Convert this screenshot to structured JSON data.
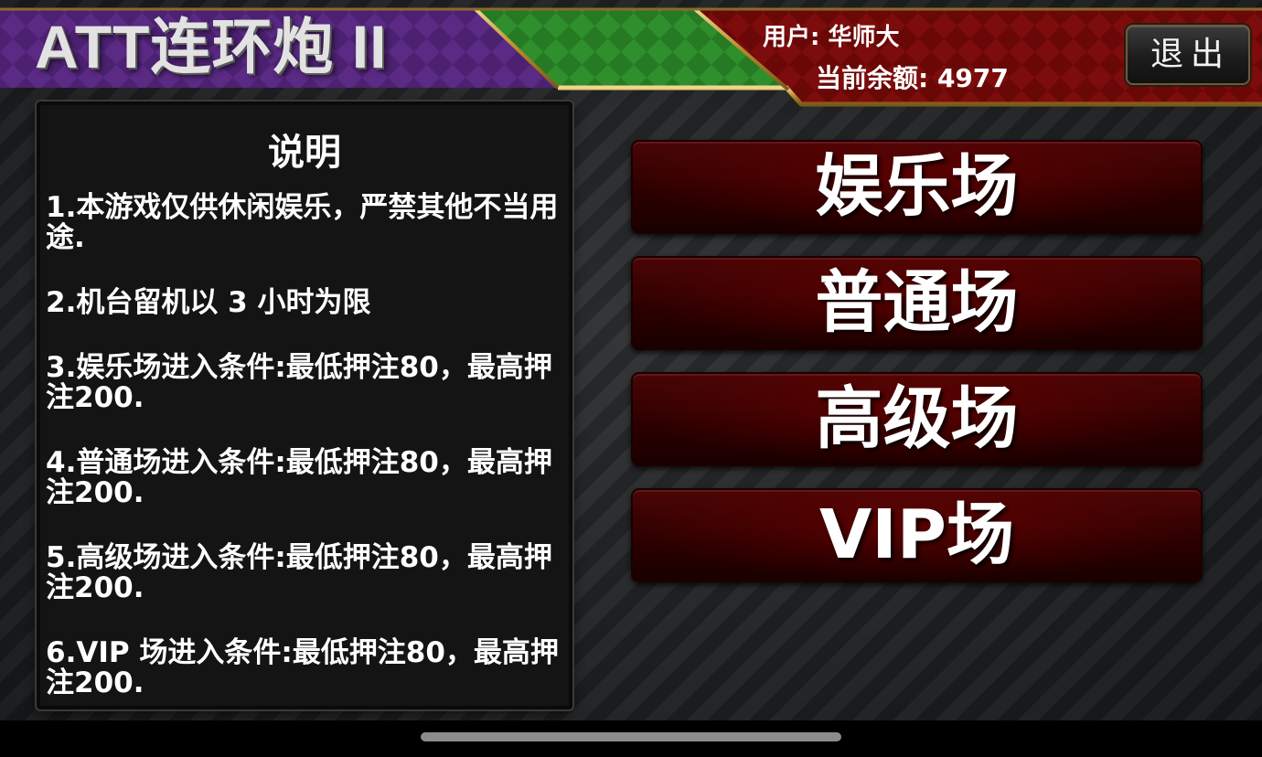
{
  "header": {
    "game_title": "ATT连环炮 II",
    "user_text": "用户: 华师大",
    "balance_text": "当前余额: 4977",
    "exit_label": "退出"
  },
  "instructions": {
    "title": "说明",
    "rules": [
      "1.本游戏仅供休闲娱乐，严禁其他不当用途.",
      "2.机台留机以  3 小时为限",
      "3.娱乐场进入条件:最低押注80，最高押注200.",
      "4.普通场进入条件:最低押注80，最高押注200.",
      "5.高级场进入条件:最低押注80，最高押注200.",
      "6.VIP 场进入条件:最低押注80，最高押注200."
    ]
  },
  "rooms": {
    "entertainment": "娱乐场",
    "normal": "普通场",
    "advanced": "高级场",
    "vip": "VIP场"
  },
  "colors": {
    "title_bar_purple": "#5b2a86",
    "title_bar_green": "#2e8a2c",
    "title_bar_red": "#7a0b0b",
    "gold_trim": "#c9a24a",
    "room_button_red": "#3a0202"
  }
}
